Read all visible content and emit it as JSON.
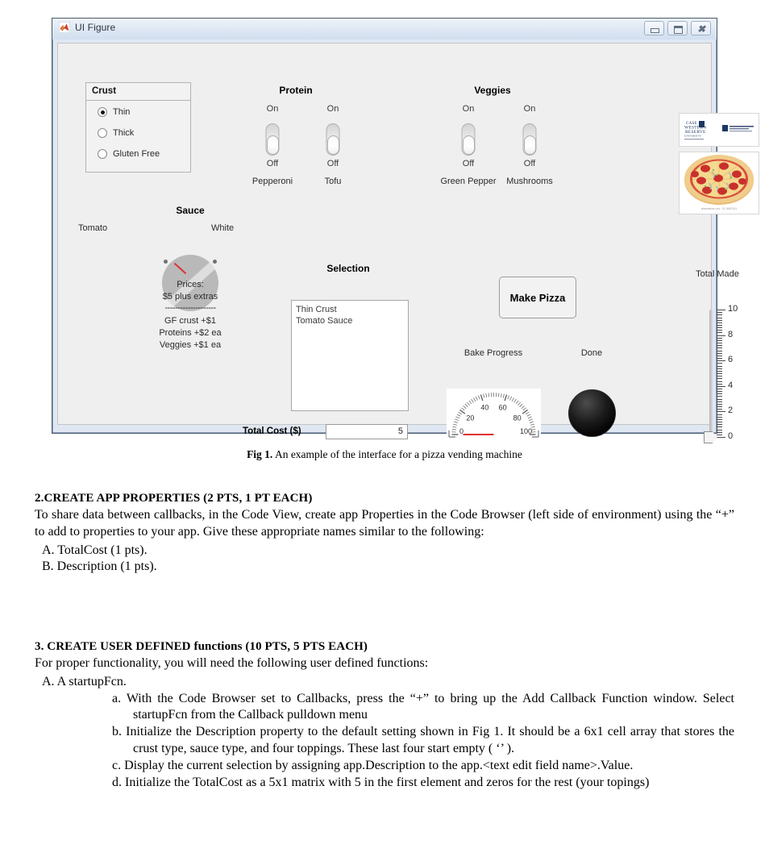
{
  "window": {
    "title": "UI Figure",
    "icon": "matlab-icon",
    "buttons": {
      "minimize": "minimize",
      "maximize": "maximize",
      "close": "close"
    }
  },
  "crust_panel": {
    "title": "Crust",
    "options": [
      {
        "label": "Thin",
        "selected": true
      },
      {
        "label": "Thick",
        "selected": false
      },
      {
        "label": "Gluten Free",
        "selected": false
      }
    ]
  },
  "protein": {
    "title": "Protein",
    "switches": [
      {
        "caption": "Pepperoni",
        "on_label": "On",
        "off_label": "Off",
        "state": "Off"
      },
      {
        "caption": "Tofu",
        "on_label": "On",
        "off_label": "Off",
        "state": "Off"
      }
    ]
  },
  "veggies": {
    "title": "Veggies",
    "switches": [
      {
        "caption": "Green Pepper",
        "on_label": "On",
        "off_label": "Off",
        "state": "Off"
      },
      {
        "caption": "Mushrooms",
        "on_label": "On",
        "off_label": "Off",
        "state": "Off"
      }
    ]
  },
  "sauce": {
    "title": "Sauce",
    "left_label": "Tomato",
    "right_label": "White",
    "value": "Tomato"
  },
  "prices": {
    "line1": "Prices:",
    "line2": "$5 plus extras",
    "divider": "--------------------",
    "line3": "GF crust +$1",
    "line4": "Proteins +$2 ea",
    "line5": "Veggies +$1 ea"
  },
  "selection": {
    "title": "Selection",
    "items": [
      "Thin Crust",
      "Tomato Sauce"
    ]
  },
  "total_cost": {
    "label": "Total Cost ($)",
    "value": "5"
  },
  "make_pizza": {
    "label": "Make Pizza"
  },
  "bake_progress": {
    "label": "Bake Progress",
    "value": 0,
    "limits": [
      0,
      100
    ],
    "major_ticks": [
      "0",
      "20",
      "40",
      "60",
      "80",
      "100"
    ]
  },
  "done_lamp": {
    "label": "Done",
    "color": "#000000",
    "state": "off"
  },
  "total_made": {
    "label": "Total Made",
    "value": 0,
    "limits": [
      0,
      10
    ],
    "major_ticks": [
      "0",
      "2",
      "4",
      "6",
      "8",
      "10"
    ]
  },
  "images": {
    "logo": "case-western-reserve-university-logo",
    "pizza": "pepperoni-pizza-clipart"
  },
  "figure_caption": {
    "label": "Fig 1.",
    "text": " An example of the interface for a pizza vending machine"
  },
  "document": {
    "section2": {
      "number": "2.",
      "title_a": "C",
      "title_b": "REATE ",
      "title_c": "A",
      "title_d": "PP ",
      "title_e": "P",
      "title_f": "ROPERTIES ",
      "title_g": "(2 ",
      "title_h": "PTS, ",
      "title_i": "1 ",
      "title_j": "PT EACH)",
      "heading_plain": "2.CREATE APP PROPERTIES (2 PTS, 1 PT EACH)",
      "body": "To share data between callbacks, in the Code View, create app Properties in the Code Browser (left side of environment) using the “+” to add to properties to your app.  Give these appropriate names similar to the following:",
      "items": [
        "A.  TotalCost  (1 pts).",
        "B.  Description (1 pts)."
      ]
    },
    "section3": {
      "heading_plain": "3. CREATE USER DEFINED functions (10 PTS, 5 PTS EACH)",
      "body": "For proper functionality, you will need the following user defined functions:",
      "item_a": "A.  A startupFcn.",
      "subitems": [
        "a.  With the Code Browser set to Callbacks, press the “+” to bring up the Add Callback Function window.  Select startupFcn from the Callback pulldown menu",
        "b.  Initialize the Description property to the default setting shown in Fig 1.  It should be a 6x1 cell array that stores the crust type, sauce type, and four toppings.  These last four start empty ( ‘’ ).",
        "c.  Display the current selection by assigning app.Description to the app.<text edit field name>.Value.",
        "d.  Initialize the TotalCost as a 5x1 matrix with 5 in the first element and zeros for the rest (your topings)"
      ]
    }
  },
  "colors": {
    "figure_bg": "#efefef",
    "window_frame": "#dfe7f2",
    "needle_red": "#e03030",
    "lamp_black": "#000000"
  }
}
